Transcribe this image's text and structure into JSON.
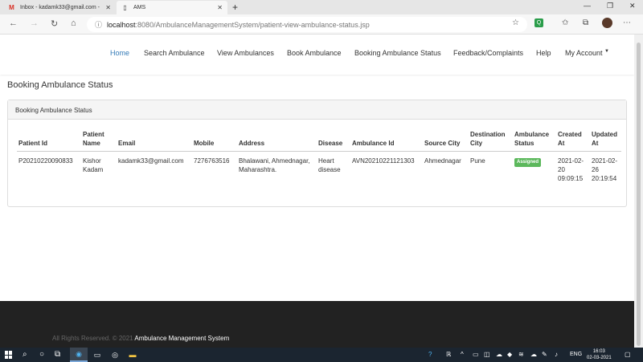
{
  "browser": {
    "tabs": [
      {
        "title": "Inbox - kadamk33@gmail.com -",
        "icon": "gmail-icon"
      },
      {
        "title": "AMS",
        "icon": "page-icon"
      }
    ],
    "url_host": "localhost",
    "url_rest": ":8080/AmbulanceManagementSystem/patient-view-ambulance-status.jsp",
    "extension_label": "Q"
  },
  "nav": {
    "items": [
      "Home",
      "Search Ambulance",
      "View Ambulances",
      "Book Ambulance",
      "Booking Ambulance Status",
      "Feedback/Complaints",
      "Help",
      "My Account"
    ],
    "active_index": 0
  },
  "page": {
    "heading": "Booking Ambulance Status",
    "panel_title": "Booking Ambulance Status"
  },
  "table": {
    "headers": [
      "Patient Id",
      "Patient Name",
      "Email",
      "Mobile",
      "Address",
      "Disease",
      "Ambulance Id",
      "Source City",
      "Destination City",
      "Ambulance Status",
      "Created At",
      "Updated At"
    ],
    "rows": [
      {
        "patient_id": "P20210220090833",
        "patient_name": "Kishor Kadam",
        "email": "kadamk33@gmail.com",
        "mobile": "7276763516",
        "address": "Bhalawani, Ahmednagar, Maharashtra.",
        "disease": "Heart disease",
        "ambulance_id": "AVN20210221121303",
        "source_city": "Ahmednagar",
        "destination_city": "Pune",
        "status": "Assigned",
        "created_at": "2021-02-20 09:09:15",
        "updated_at": "2021-02-26 20:19:54"
      }
    ]
  },
  "footer": {
    "prefix": "All Rights Reserved. © 2021",
    "brand": "Ambulance Management System"
  },
  "taskbar": {
    "lang": "ENG",
    "time": "16:03",
    "date": "02-03-2021"
  },
  "colors": {
    "accent": "#337ab7",
    "status_badge": "#5cb85c",
    "footer_bg": "#222222"
  }
}
